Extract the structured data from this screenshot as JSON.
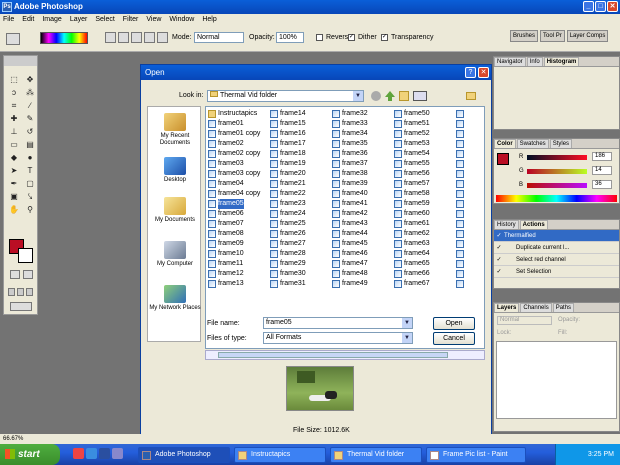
{
  "app": {
    "title": "Adobe Photoshop"
  },
  "menubar": [
    "File",
    "Edit",
    "Image",
    "Layer",
    "Select",
    "Filter",
    "View",
    "Window",
    "Help"
  ],
  "options": {
    "mode_label": "Mode:",
    "mode_value": "Normal",
    "opacity_label": "Opacity:",
    "opacity_value": "100%",
    "reverse_label": "Reverse",
    "reverse_checked": false,
    "dither_label": "Dither",
    "dither_checked": true,
    "transparency_label": "Transparency",
    "transparency_checked": true
  },
  "palette_well": [
    "Brushes",
    "Tool Pr",
    "Layer Comps"
  ],
  "status": {
    "zoom": "66.67%"
  },
  "dialog": {
    "title": "Open",
    "help_glyph": "?",
    "close_glyph": "✕",
    "look_in_label": "Look in:",
    "look_in_value": "Thermal Vid folder",
    "places": [
      "My Recent Documents",
      "Desktop",
      "My Documents",
      "My Computer",
      "My Network Places"
    ],
    "columns": [
      [
        "Instructapics",
        "frame01",
        "frame01 copy",
        "frame02",
        "frame02 copy",
        "frame03",
        "frame03 copy",
        "frame04",
        "frame04 copy",
        "frame05",
        "frame06",
        "frame07",
        "frame08",
        "frame09",
        "frame10",
        "frame11",
        "frame12",
        "frame13"
      ],
      [
        "frame14",
        "frame15",
        "frame16",
        "frame17",
        "frame18",
        "frame19",
        "frame20",
        "frame21",
        "frame22",
        "frame23",
        "frame24",
        "frame25",
        "frame26",
        "frame27",
        "frame28",
        "frame29",
        "frame30",
        "frame31"
      ],
      [
        "frame32",
        "frame33",
        "frame34",
        "frame35",
        "frame36",
        "frame37",
        "frame38",
        "frame39",
        "frame40",
        "frame41",
        "frame42",
        "frame43",
        "frame44",
        "frame45",
        "frame46",
        "frame47",
        "frame48",
        "frame49"
      ],
      [
        "frame50",
        "frame51",
        "frame52",
        "frame53",
        "frame54",
        "frame55",
        "frame56",
        "frame57",
        "frame58",
        "frame59",
        "frame60",
        "frame61",
        "frame62",
        "frame63",
        "frame64",
        "frame65",
        "frame66",
        "frame67"
      ]
    ],
    "selected_file": "frame05",
    "file_name_label": "File name:",
    "file_name_value": "frame05",
    "file_type_label": "Files of type:",
    "file_type_value": "All Formats",
    "open_button": "Open",
    "cancel_button": "Cancel",
    "file_size": "File Size: 1012.6K"
  },
  "panels": {
    "navigator_tabs": [
      "Navigator",
      "Info",
      "Histogram"
    ],
    "color_tabs": [
      "Color",
      "Swatches",
      "Styles"
    ],
    "color": {
      "r_label": "R",
      "r_value": "186",
      "g_label": "G",
      "g_value": "14",
      "b_label": "B",
      "b_value": "36",
      "foreground": "#ba0e24"
    },
    "history_tabs": [
      "History",
      "Actions"
    ],
    "actions": [
      "Thermalfied",
      "Duplicate current l...",
      "Select red channel",
      "Set Selection"
    ],
    "layers_tabs": [
      "Layers",
      "Channels",
      "Paths"
    ],
    "layers_blend": "Normal",
    "layers_opacity_label": "Opacity:",
    "layers_lock_label": "Lock:",
    "layers_fill_label": "Fill:"
  },
  "taskbar": {
    "start": "start",
    "tasks": [
      "Adobe Photoshop",
      "Instructapics",
      "Thermal Vid folder",
      "Frame Pic list - Paint"
    ],
    "active_task": "Adobe Photoshop",
    "clock": "3:25 PM"
  },
  "colors": {
    "accent": "#0a5fd8",
    "selection": "#316ac5",
    "foreground_swatch": "#ba0e24"
  }
}
